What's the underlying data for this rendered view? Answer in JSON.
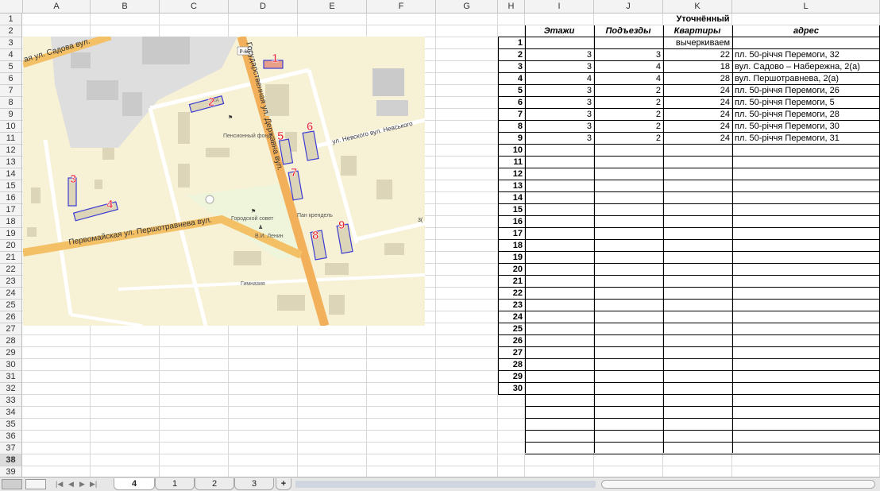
{
  "columns": [
    "A",
    "B",
    "C",
    "D",
    "E",
    "F",
    "G",
    "H",
    "I",
    "J",
    "K",
    "L"
  ],
  "rows": [
    "1",
    "2",
    "3",
    "4",
    "5",
    "6",
    "7",
    "8",
    "9",
    "10",
    "11",
    "12",
    "13",
    "14",
    "15",
    "16",
    "17",
    "18",
    "19",
    "20",
    "21",
    "22",
    "23",
    "24",
    "25",
    "26",
    "27",
    "28",
    "29",
    "30",
    "31",
    "32",
    "33",
    "34",
    "35",
    "36",
    "37",
    "38",
    "39"
  ],
  "table": {
    "header_top": "Уточнённый",
    "headers": [
      "Этажи",
      "Подъезды",
      "Квартиры",
      "адрес"
    ],
    "row1_note": "вычеркиваем",
    "row_numbers": [
      "1",
      "2",
      "3",
      "4",
      "5",
      "6",
      "7",
      "8",
      "9",
      "10",
      "11",
      "12",
      "13",
      "14",
      "15",
      "16",
      "17",
      "18",
      "19",
      "20",
      "21",
      "22",
      "23",
      "24",
      "25",
      "26",
      "27",
      "28",
      "29",
      "30"
    ],
    "data": [
      {
        "floors": "3",
        "entrances": "3",
        "apartments": "22",
        "address": "пл. 50-річчя Перемоги, 32"
      },
      {
        "floors": "3",
        "entrances": "4",
        "apartments": "18",
        "address": "вул. Садово – Набережна, 2(а)"
      },
      {
        "floors": "4",
        "entrances": "4",
        "apartments": "28",
        "address": "вул. Першотравнева, 2(а)"
      },
      {
        "floors": "3",
        "entrances": "2",
        "apartments": "24",
        "address": "пл. 50-річчя Перемоги, 26"
      },
      {
        "floors": "3",
        "entrances": "2",
        "apartments": "24",
        "address": "пл. 50-річчя Перемоги, 5"
      },
      {
        "floors": "3",
        "entrances": "2",
        "apartments": "24",
        "address": "пл. 50-річчя Перемоги, 28"
      },
      {
        "floors": "3",
        "entrances": "2",
        "apartments": "24",
        "address": "пл. 50-річчя Перемоги, 30"
      },
      {
        "floors": "3",
        "entrances": "2",
        "apartments": "24",
        "address": "пл. 50-річчя Перемоги, 31"
      }
    ]
  },
  "map": {
    "streets": {
      "sadova": "ая ул. Садова вул.",
      "derzhavna": "Государственная ул. Державна вул.",
      "pershotravneva": "Первомайская ул. Першотравнева вул.",
      "nevskogo": "ул. Невского вул. Невського",
      "road_label": "Р-66",
      "lot": "32А",
      "edge_num": "3("
    },
    "places": {
      "pension": "Пенсионный фонд",
      "council": "Городской совет",
      "lenin": "В.И. Ленин",
      "gymnasium": "Гимназия",
      "cafe": "Пан крендель"
    },
    "markers": [
      "1",
      "2",
      "3",
      "4",
      "5",
      "6",
      "7",
      "8",
      "9"
    ]
  },
  "tabs": [
    "4",
    "1",
    "2",
    "3"
  ],
  "active_tab": "4",
  "add_tab": "+",
  "colors": {
    "marker": "#e8202a",
    "building_outline": "#3b3bd4",
    "road": "#f2b05a",
    "map_bg": "#f7f1d6"
  }
}
